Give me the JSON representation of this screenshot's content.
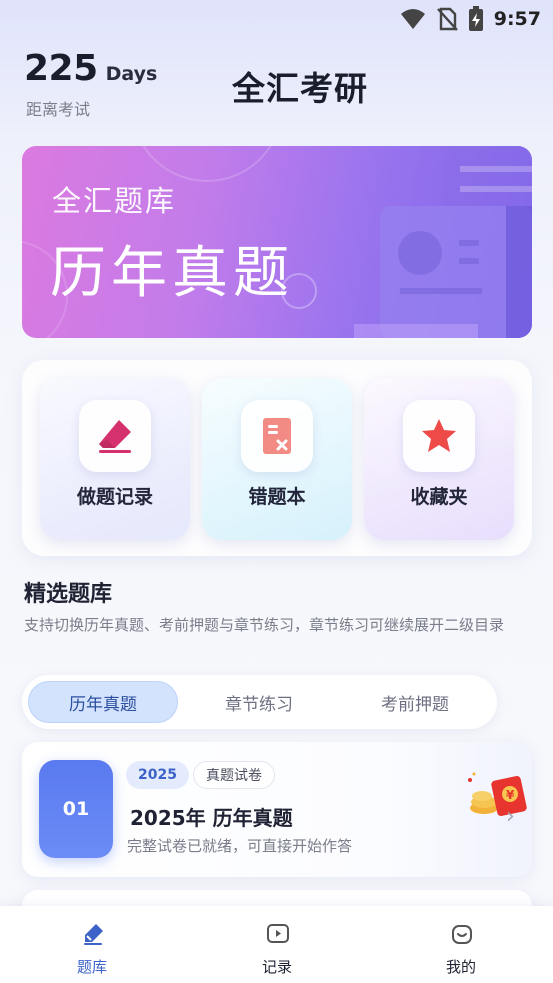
{
  "status_bar": {
    "time": "9:57"
  },
  "header": {
    "days_number": "225",
    "days_unit": "Days",
    "days_label": "距离考试",
    "app_title": "全汇考研"
  },
  "banner": {
    "subtitle": "全汇题库",
    "title": "历年真题"
  },
  "quick_actions": [
    {
      "label": "做题记录",
      "icon": "eraser-icon",
      "color": "#d6316f"
    },
    {
      "label": "错题本",
      "icon": "wrong-note-icon",
      "color": "#f28b83"
    },
    {
      "label": "收藏夹",
      "icon": "star-icon",
      "color": "#ee4a48"
    }
  ],
  "section": {
    "title": "精选题库",
    "description": "支持切换历年真题、考前押题与章节练习，章节练习可继续展开二级目录"
  },
  "tabs": [
    {
      "label": "历年真题",
      "active": true
    },
    {
      "label": "章节练习",
      "active": false
    },
    {
      "label": "考前押题",
      "active": false
    }
  ],
  "exam_list": [
    {
      "index": "01",
      "year_badge": "2025",
      "type_badge": "真题试卷",
      "title": "2025年 历年真题",
      "description": "完整试卷已就绪，可直接开始作答"
    }
  ],
  "bottom_nav": [
    {
      "label": "题库",
      "icon": "question-bank-icon",
      "active": true
    },
    {
      "label": "记录",
      "icon": "play-record-icon",
      "active": false
    },
    {
      "label": "我的",
      "icon": "profile-icon",
      "active": false
    }
  ],
  "colors": {
    "accent": "#3d63c9",
    "banner_start": "#db7ae0",
    "banner_end": "#7c66ea",
    "index_badge": "#5a7af0"
  }
}
